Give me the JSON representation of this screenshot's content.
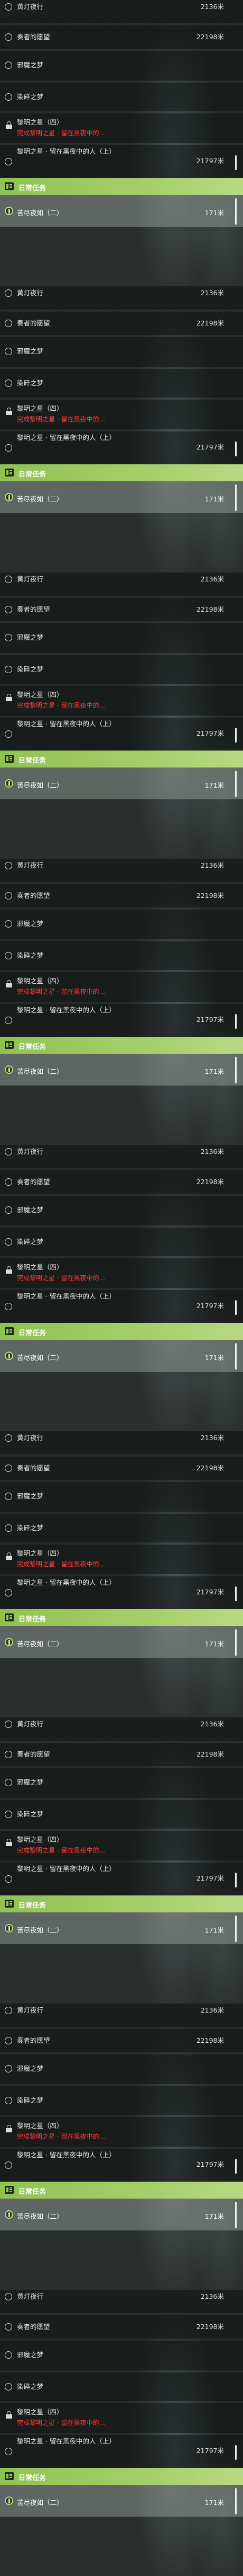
{
  "rows": [
    {
      "title": "黄灯夜行",
      "distance": "2136米"
    },
    {
      "title": "奏者的愿望",
      "distance": "22198米"
    },
    {
      "title": "邪魔之梦"
    },
    {
      "title": "染碎之梦"
    },
    {
      "title": "黎明之星（四）",
      "subtitle": "完成黎明之星 · 留在黑夜中的..."
    },
    {
      "title": "黎明之星 · 留在黑夜中的人（上）",
      "distance": "21797米"
    }
  ],
  "section": {
    "label": "日常任务"
  },
  "daily": {
    "title": "苦尽夜如（二）",
    "distance": "171米"
  },
  "icons": {
    "quest": "circle-outline-icon",
    "locked": "lock-icon",
    "section": "task-list-icon",
    "daily": "daily-quest-icon"
  },
  "colors": {
    "section_green": "#9cc95e",
    "warning_red": "#ff3a3a"
  }
}
